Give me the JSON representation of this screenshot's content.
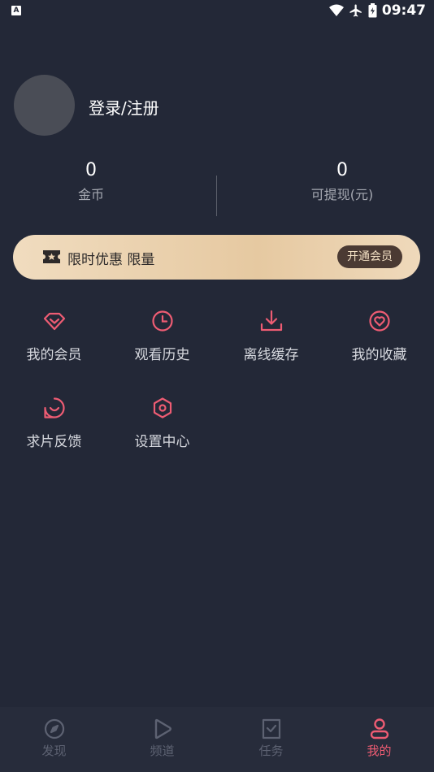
{
  "status_bar": {
    "time": "09:47",
    "left_badge": "A"
  },
  "profile": {
    "login_label": "登录/注册"
  },
  "stats": [
    {
      "value": "0",
      "label": "金币"
    },
    {
      "value": "0",
      "label": "可提现(元)"
    }
  ],
  "promo": {
    "text": "限时优惠 限量",
    "button_label": "开通会员"
  },
  "menu": [
    {
      "label": "我的会员",
      "icon": "diamond-icon"
    },
    {
      "label": "观看历史",
      "icon": "clock-icon"
    },
    {
      "label": "离线缓存",
      "icon": "download-icon"
    },
    {
      "label": "我的收藏",
      "icon": "heart-circle-icon"
    },
    {
      "label": "求片反馈",
      "icon": "feedback-icon"
    },
    {
      "label": "设置中心",
      "icon": "settings-icon"
    }
  ],
  "tabs": [
    {
      "label": "发现",
      "icon": "compass-icon"
    },
    {
      "label": "频道",
      "icon": "play-icon"
    },
    {
      "label": "任务",
      "icon": "task-icon"
    },
    {
      "label": "我的",
      "icon": "user-icon",
      "active": true
    }
  ],
  "colors": {
    "background": "#232837",
    "accent": "#ee5c73",
    "promo_gold": "#e6c9a1",
    "tab_inactive": "#5d6272"
  }
}
